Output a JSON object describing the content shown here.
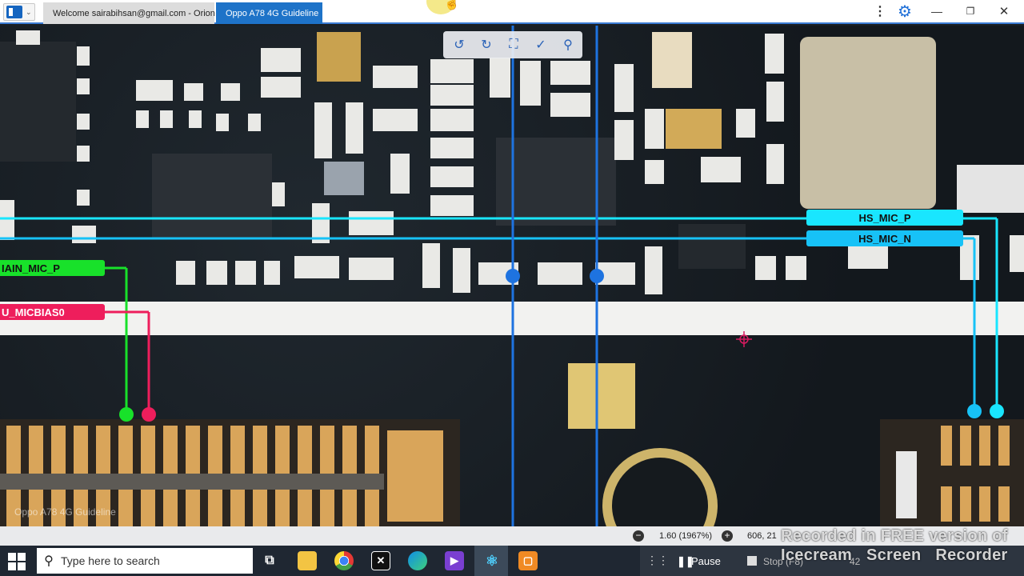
{
  "window": {
    "tabs": [
      {
        "label": "Welcome sairabihsan@gmail.com - Orion",
        "active": false
      },
      {
        "label": "Oppo A78 4G Guideline",
        "active": true
      }
    ],
    "controls": {
      "more": "⋮",
      "settings": "⚙",
      "minimize": "—",
      "maximize": "❐",
      "close": "✕"
    }
  },
  "viewer": {
    "toolbar": [
      "rotate-left-icon",
      "rotate-right-icon",
      "fit-screen-icon",
      "measure-icon",
      "zoom-icon"
    ],
    "net_labels": {
      "hs_mic_p": "HS_MIC_P",
      "hs_mic_n": "HS_MIC_N",
      "main_mic_p": "IAIN_MIC_P",
      "micbias": "U_MICBIAS0"
    },
    "board_watermark": "Oppo A78 4G Guideline",
    "colors": {
      "hs_mic_p": "#19e6ff",
      "hs_mic_n": "#17c2f7",
      "main_mic_p": "#18e12a",
      "micbias": "#ee1e5c",
      "probe_lines": "#1e73e0"
    }
  },
  "statusbar": {
    "zoom_out": "−",
    "zoom_level": "1.60 (1967%)",
    "zoom_in": "+",
    "coords": "606, 21"
  },
  "taskbar": {
    "search_placeholder": "Type here to search",
    "apps": [
      "task-view",
      "file-explorer",
      "chrome",
      "capcut",
      "edge",
      "visual-studio",
      "react-app",
      "icecream-recorder"
    ]
  },
  "recorder": {
    "pause_label": "Pause",
    "stop_label": "Stop (F8)",
    "time": "42",
    "watermark_line1": "Recorded in FREE version of",
    "watermark_line2": "Icecream Screen Recorder"
  }
}
